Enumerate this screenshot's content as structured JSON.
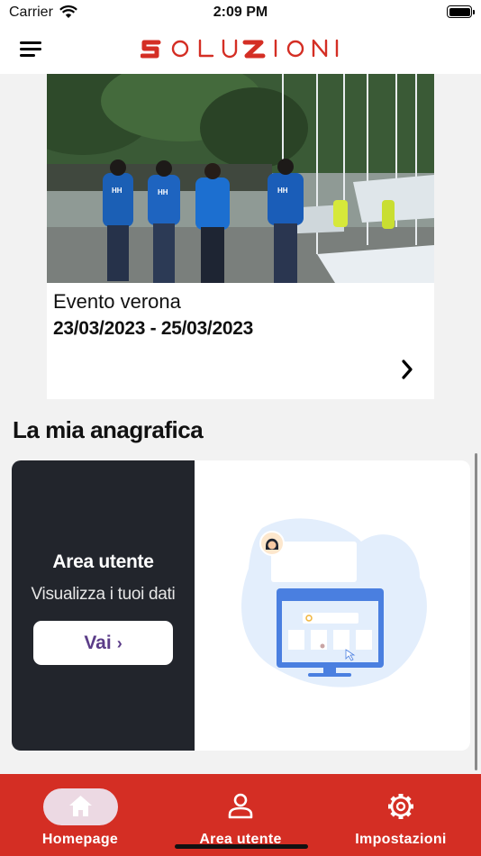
{
  "status_bar": {
    "carrier": "Carrier",
    "time": "2:09 PM"
  },
  "header": {
    "logo_text": "SOLUZIONI",
    "brand_color": "#d42e24"
  },
  "event": {
    "title": "Evento verona",
    "dates": "23/03/2023 - 25/03/2023"
  },
  "profile_section": {
    "title": "La mia anagrafica",
    "heading": "Area utente",
    "subtitle": "Visualizza i tuoi dati",
    "button_label": "Vai",
    "button_icon": "chevron-right-icon"
  },
  "tabs": [
    {
      "label": "Homepage",
      "icon": "home-icon",
      "active": true
    },
    {
      "label": "Area utente",
      "icon": "user-icon",
      "active": false
    },
    {
      "label": "Impostazioni",
      "icon": "gear-icon",
      "active": false
    }
  ],
  "colors": {
    "tabbar": "#d42e24",
    "dark_panel": "#22252c",
    "button_text": "#5b3c88"
  }
}
